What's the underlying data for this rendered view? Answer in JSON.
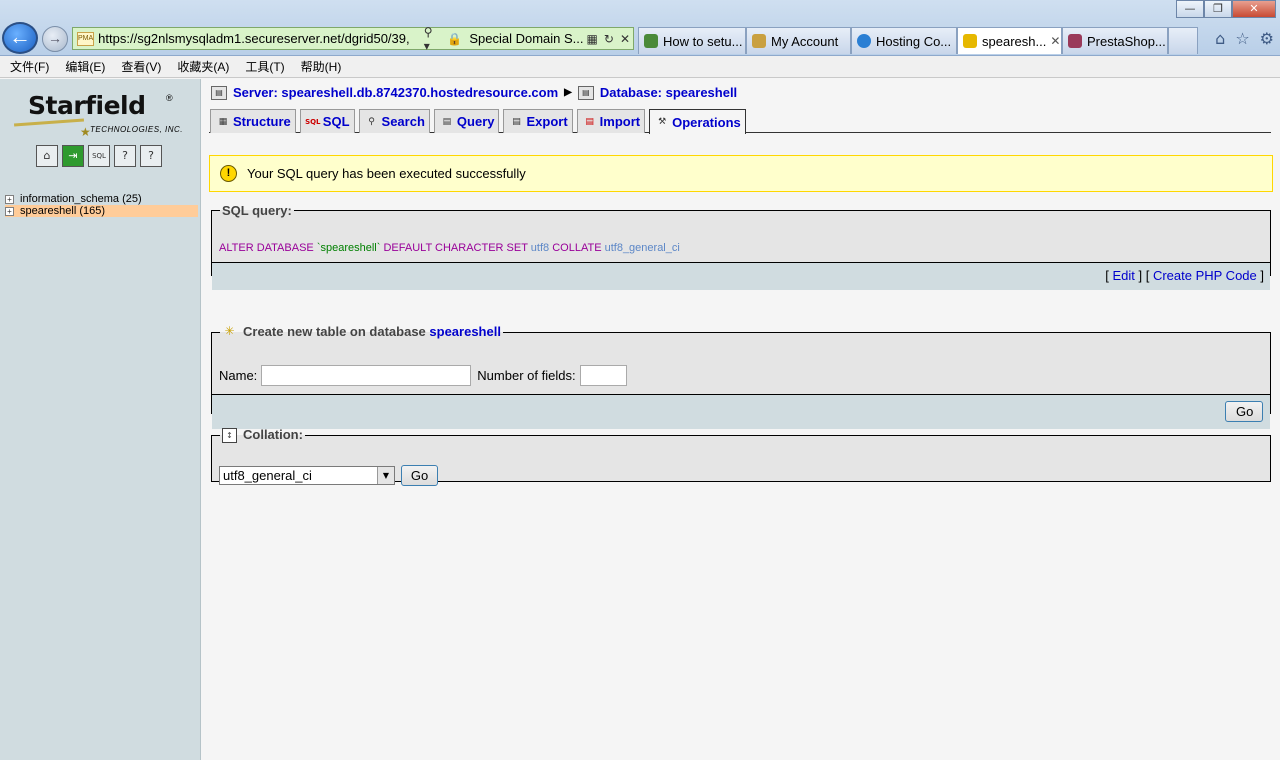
{
  "browser": {
    "address": {
      "url": "https://sg2nlsmysqladm1.secureserver.net/dgrid50/39,",
      "site_label": "Special Domain S...",
      "favicon_text": "PMA"
    },
    "tabs": [
      {
        "label": "How to setu...",
        "icon_color": "#4a8a3a"
      },
      {
        "label": "My Account",
        "icon_color": "#c9a040"
      },
      {
        "label": "Hosting Co...",
        "icon_color": "#2a7fd4"
      },
      {
        "label": "spearesh...",
        "icon_color": "#e6b800",
        "active": true
      },
      {
        "label": "PrestaShop...",
        "icon_color": "#9a3a5a"
      }
    ],
    "menu": [
      "文件(F)",
      "编辑(E)",
      "查看(V)",
      "收藏夹(A)",
      "工具(T)",
      "帮助(H)"
    ]
  },
  "sidebar": {
    "logo": {
      "brand": "Starfield",
      "reg": "®",
      "sub": "TECHNOLOGIES, INC."
    },
    "nav_icons": [
      "home-icon",
      "exit-icon",
      "sql-window-icon",
      "query-docs-icon",
      "docs-icon"
    ],
    "databases": [
      {
        "label": "information_schema (25)",
        "selected": false
      },
      {
        "label": "speareshell (165)",
        "selected": true
      }
    ]
  },
  "main": {
    "breadcrumb": {
      "server": "Server: speareshell.db.8742370.hostedresource.com",
      "database": "Database: speareshell"
    },
    "tabs": [
      {
        "label": "Structure",
        "icon": "structure-icon"
      },
      {
        "label": "SQL",
        "icon": "sql-icon"
      },
      {
        "label": "Search",
        "icon": "search-icon"
      },
      {
        "label": "Query",
        "icon": "query-icon"
      },
      {
        "label": "Export",
        "icon": "export-icon"
      },
      {
        "label": "Import",
        "icon": "import-icon"
      },
      {
        "label": "Operations",
        "icon": "operations-icon",
        "active": true
      }
    ],
    "notice": "Your SQL query has been executed successfully",
    "sql_query": {
      "legend": "SQL query:",
      "kw1": "ALTER DATABASE",
      "db": "`speareshell`",
      "kw2": "DEFAULT CHARACTER SET",
      "charset": "utf8",
      "kw3": "COLLATE",
      "collation": "utf8_general_ci",
      "edit_label": "Edit",
      "php_label": "Create PHP Code"
    },
    "create_table": {
      "legend_prefix": "Create new table on database",
      "legend_db": "speareshell",
      "name_label": "Name:",
      "name_value": "",
      "fields_label": "Number of fields:",
      "fields_value": "",
      "go_label": "Go"
    },
    "collation": {
      "legend": "Collation:",
      "selected": "utf8_general_ci",
      "go_label": "Go"
    }
  }
}
